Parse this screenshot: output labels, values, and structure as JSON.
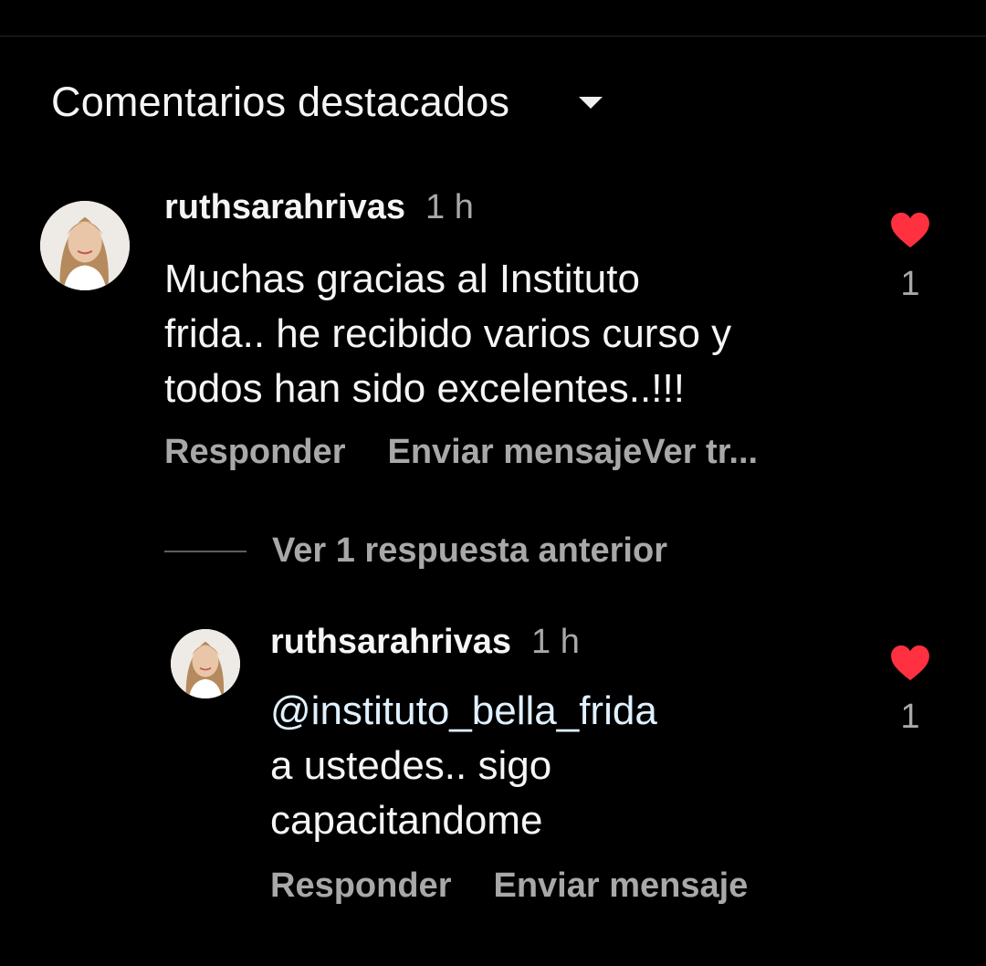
{
  "header": {
    "sort_label": "Comentarios destacados",
    "sort_icon": "chevron-down-icon"
  },
  "comments": [
    {
      "username": "ruthsarahrivas",
      "time": "1 h",
      "text_lines": [
        "Muchas gracias al Instituto",
        "frida.. he recibido varios curso y",
        "todos han sido excelentes..!!!"
      ],
      "actions": {
        "reply": "Responder",
        "send": "Enviar mensajeVer tr..."
      },
      "likes": "1",
      "liked": true
    }
  ],
  "replies_toggle": {
    "label": "Ver 1 respuesta anterior"
  },
  "replies": [
    {
      "username": "ruthsarahrivas",
      "time": "1 h",
      "mention": "@instituto_bella_frida",
      "text_lines": [
        "a ustedes.. sigo",
        "capacitandome"
      ],
      "actions": {
        "reply": "Responder",
        "send": "Enviar mensaje"
      },
      "likes": "1",
      "liked": true
    }
  ],
  "colors": {
    "background": "#000000",
    "primary_text": "#f5f5f5",
    "secondary_text": "#a8a8a8",
    "like_red": "#ff3040",
    "mention": "#e0f1ff"
  }
}
